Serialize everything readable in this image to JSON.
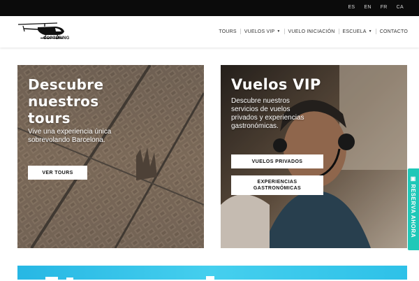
{
  "top_bar": {
    "languages": [
      "ES",
      "EN",
      "FR",
      "CA"
    ]
  },
  "header": {
    "brand": "COPTERING",
    "nav": [
      {
        "label": "TOURS",
        "dropdown": false
      },
      {
        "label": "VUELOS VIP",
        "dropdown": true
      },
      {
        "label": "VUELO INICIACIÓN",
        "dropdown": false
      },
      {
        "label": "ESCUELA",
        "dropdown": true
      },
      {
        "label": "CONTACTO",
        "dropdown": false
      }
    ]
  },
  "cards": {
    "tours": {
      "title_lines": [
        "Descubre",
        "nuestros",
        "tours"
      ],
      "desc_lines": [
        "Vive una experiencia única",
        "sobrevolando Barcelona."
      ],
      "button": "VER TOURS"
    },
    "vip": {
      "title": "Vuelos VIP",
      "desc_lines": [
        "Descubre nuestros",
        "servicios de vuelos",
        "privados y experiencias",
        "gastronómicas."
      ],
      "button_private": "VUELOS PRIVADOS",
      "button_gastro_lines": [
        "EXPERIENCIAS",
        "GASTRONÓMICAS"
      ]
    }
  },
  "side_tab": {
    "label": "RESERVA AHORA"
  },
  "colors": {
    "top_bar": "#0b0b0b",
    "accent_tab": "#1fc8b8",
    "bottom_banner": "#3ec8ec"
  }
}
